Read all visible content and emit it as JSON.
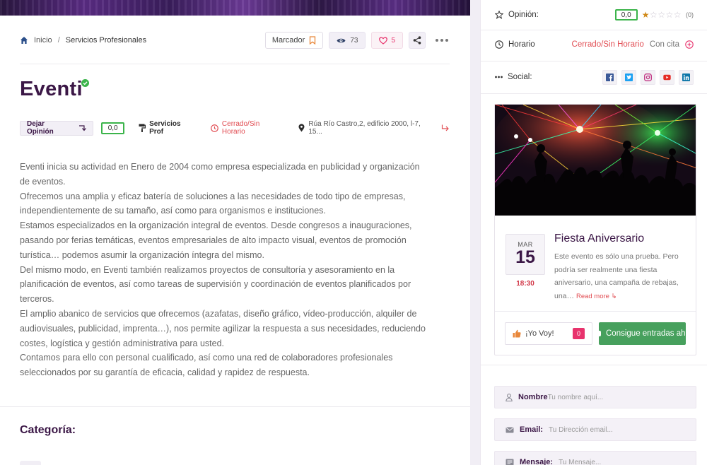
{
  "breadcrumb": {
    "home": "Inicio",
    "separator": "/",
    "current": "Servicios Profesionales"
  },
  "actions": {
    "bookmark_label": "Marcador",
    "views": "73",
    "likes": "5"
  },
  "listing": {
    "title": "Eventi",
    "review_button": "Dejar Opinión",
    "score": "0,0",
    "category": "Servicios Prof",
    "status": "Cerrado/Sin Horario",
    "address": "Rúa Río Castro,2, edificio 2000, l-7, 15..."
  },
  "description": [
    "Eventi inicia su actividad en Enero de 2004 como empresa especializada en publicidad y organización de eventos.",
    "Ofrecemos una amplia y eficaz batería de soluciones a las necesidades de todo tipo de empresas, independientemente de su tamaño, así como para organismos e instituciones.",
    "Estamos especializados en la organización integral de eventos. Desde congresos a inauguraciones, pasando por ferias temáticas, eventos empresariales de alto impacto visual, eventos de promoción turística… podemos asumir la organización íntegra del mismo.",
    "Del mismo modo, en Eventi también realizamos proyectos de consultoría y asesoramiento en la planificación de eventos, así como tareas de supervisión y coordinación de eventos planificados por terceros.",
    "El amplio abanico de servicios que ofrecemos (azafatas, diseño gráfico, vídeo-producción, alquiler de audiovisuales, publicidad, imprenta…), nos permite agilizar la respuesta a sus necesidades, reduciendo costes, logística y gestión administrativa para usted.",
    "Contamos para ello con personal cualificado, así como una red de colaboradores profesionales seleccionados por su garantía de eficacia, calidad y rapidez de respuesta."
  ],
  "category_section": {
    "title": "Categoría:"
  },
  "sidebar": {
    "opinion": {
      "label": "Opinión:",
      "score": "0,0",
      "count": "(0)",
      "stars_filled": 1,
      "stars_total": 5
    },
    "horario": {
      "label": "Horario",
      "status": "Cerrado/Sin Horario",
      "appointment": "Con cita"
    },
    "social": {
      "label": "Social:",
      "networks": [
        "facebook",
        "twitter",
        "instagram",
        "youtube",
        "linkedin"
      ]
    },
    "event": {
      "month": "MAR",
      "day": "15",
      "time": "18:30",
      "title": "Fiesta Aniversario",
      "description": "Este evento es sólo una prueba. Pero podría ser realmente una fiesta aniversario, una campaña de rebajas, una…",
      "read_more": "Read more",
      "going_label": "¡Yo Voy!",
      "going_count": "0",
      "tickets_label": "Consigue entradas aho"
    },
    "form": {
      "name_label": "Nombre",
      "name_placeholder": "Tu nombre aquí...",
      "email_label": "Email:",
      "email_placeholder": "Tu Dirección email...",
      "message_label": "Mensaje:",
      "message_placeholder": "Tu Mensaje..."
    }
  },
  "colors": {
    "brand": "#3b1746",
    "danger": "#e14c52",
    "accent_pink": "#e8336d",
    "success": "#47a05d",
    "score_border": "#3cb44b",
    "star": "#d08a1a",
    "facebook": "#3b5998",
    "twitter": "#1da1f2",
    "instagram": "#c13584",
    "youtube": "#e52d27",
    "linkedin": "#0e76a8"
  }
}
